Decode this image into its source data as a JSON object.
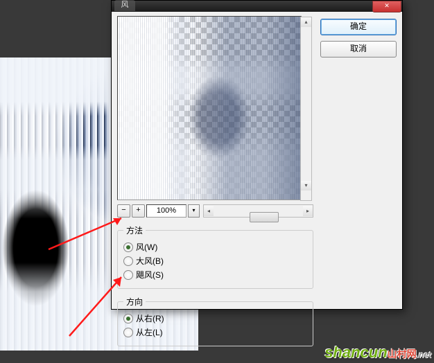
{
  "dialog": {
    "title": "风",
    "close_icon": "close",
    "ok_label": "确定",
    "cancel_label": "取消"
  },
  "zoom": {
    "minus": "−",
    "plus": "+",
    "value": "100%"
  },
  "method": {
    "legend": "方法",
    "options": [
      {
        "label": "风(W)",
        "checked": true
      },
      {
        "label": "大风(B)",
        "checked": false
      },
      {
        "label": "飓风(S)",
        "checked": false
      }
    ]
  },
  "direction": {
    "legend": "方向",
    "options": [
      {
        "label": "从右(R)",
        "checked": true
      },
      {
        "label": "从左(L)",
        "checked": false
      }
    ]
  },
  "watermark": {
    "text": "shancun",
    "sub": "山村网",
    "domain": ".net"
  }
}
